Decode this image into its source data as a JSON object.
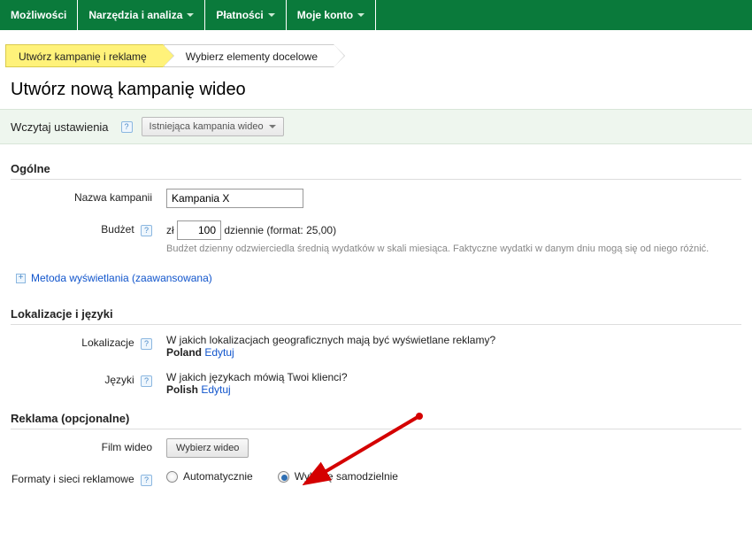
{
  "nav": {
    "items": [
      {
        "label": "Możliwości",
        "dropdown": false
      },
      {
        "label": "Narzędzia i analiza",
        "dropdown": true
      },
      {
        "label": "Płatności",
        "dropdown": true
      },
      {
        "label": "Moje konto",
        "dropdown": true
      }
    ]
  },
  "wizard": {
    "step1": "Utwórz kampanię i reklamę",
    "step2": "Wybierz elementy docelowe"
  },
  "page_title": "Utwórz nową kampanię wideo",
  "load_settings": {
    "label": "Wczytaj ustawienia",
    "button": "Istniejąca kampania wideo"
  },
  "sections": {
    "general": "Ogólne",
    "locations": "Lokalizacje i języki",
    "ad": "Reklama (opcjonalne)"
  },
  "campaign_name": {
    "label": "Nazwa kampanii",
    "value": "Kampania X"
  },
  "budget": {
    "label": "Budżet",
    "currency": "zł",
    "value": "100",
    "suffix": "dziennie (format: 25,00)",
    "hint": "Budżet dzienny odzwierciedla średnią wydatków w skali miesiąca. Faktyczne wydatki w danym dniu mogą się od niego różnić."
  },
  "delivery_method": "Metoda wyświetlania (zaawansowana)",
  "locations": {
    "label": "Lokalizacje",
    "question": "W jakich lokalizacjach geograficznych mają być wyświetlane reklamy?",
    "value": "Poland",
    "edit": "Edytuj"
  },
  "languages": {
    "label": "Języki",
    "question": "W jakich językach mówią Twoi klienci?",
    "value": "Polish",
    "edit": "Edytuj"
  },
  "video": {
    "label": "Film wideo",
    "button": "Wybierz wideo"
  },
  "formats": {
    "label": "Formaty i sieci reklamowe",
    "auto": "Automatycznie",
    "manual": "Wybiorę samodzielnie"
  }
}
